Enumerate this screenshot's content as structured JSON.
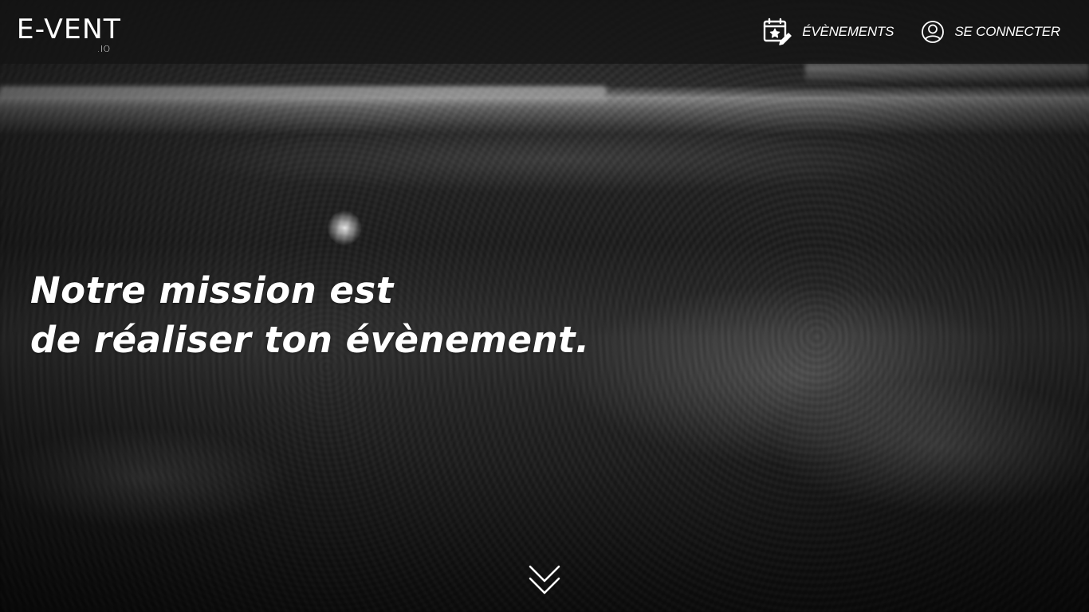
{
  "brand": {
    "logo_main": "E-VENT",
    "logo_sub": ".IO"
  },
  "nav": {
    "events": {
      "label": "ÉVÈNEMENTS",
      "icon": "calendar-star-edit-icon"
    },
    "login": {
      "label": "SE CONNECTER",
      "icon": "user-circle-icon"
    }
  },
  "hero": {
    "line1": "Notre mission est",
    "line2": "de réaliser ton évènement.",
    "scroll_icon": "double-chevron-down-icon"
  },
  "colors": {
    "navbar_bg": "#141414",
    "text": "#ffffff"
  }
}
